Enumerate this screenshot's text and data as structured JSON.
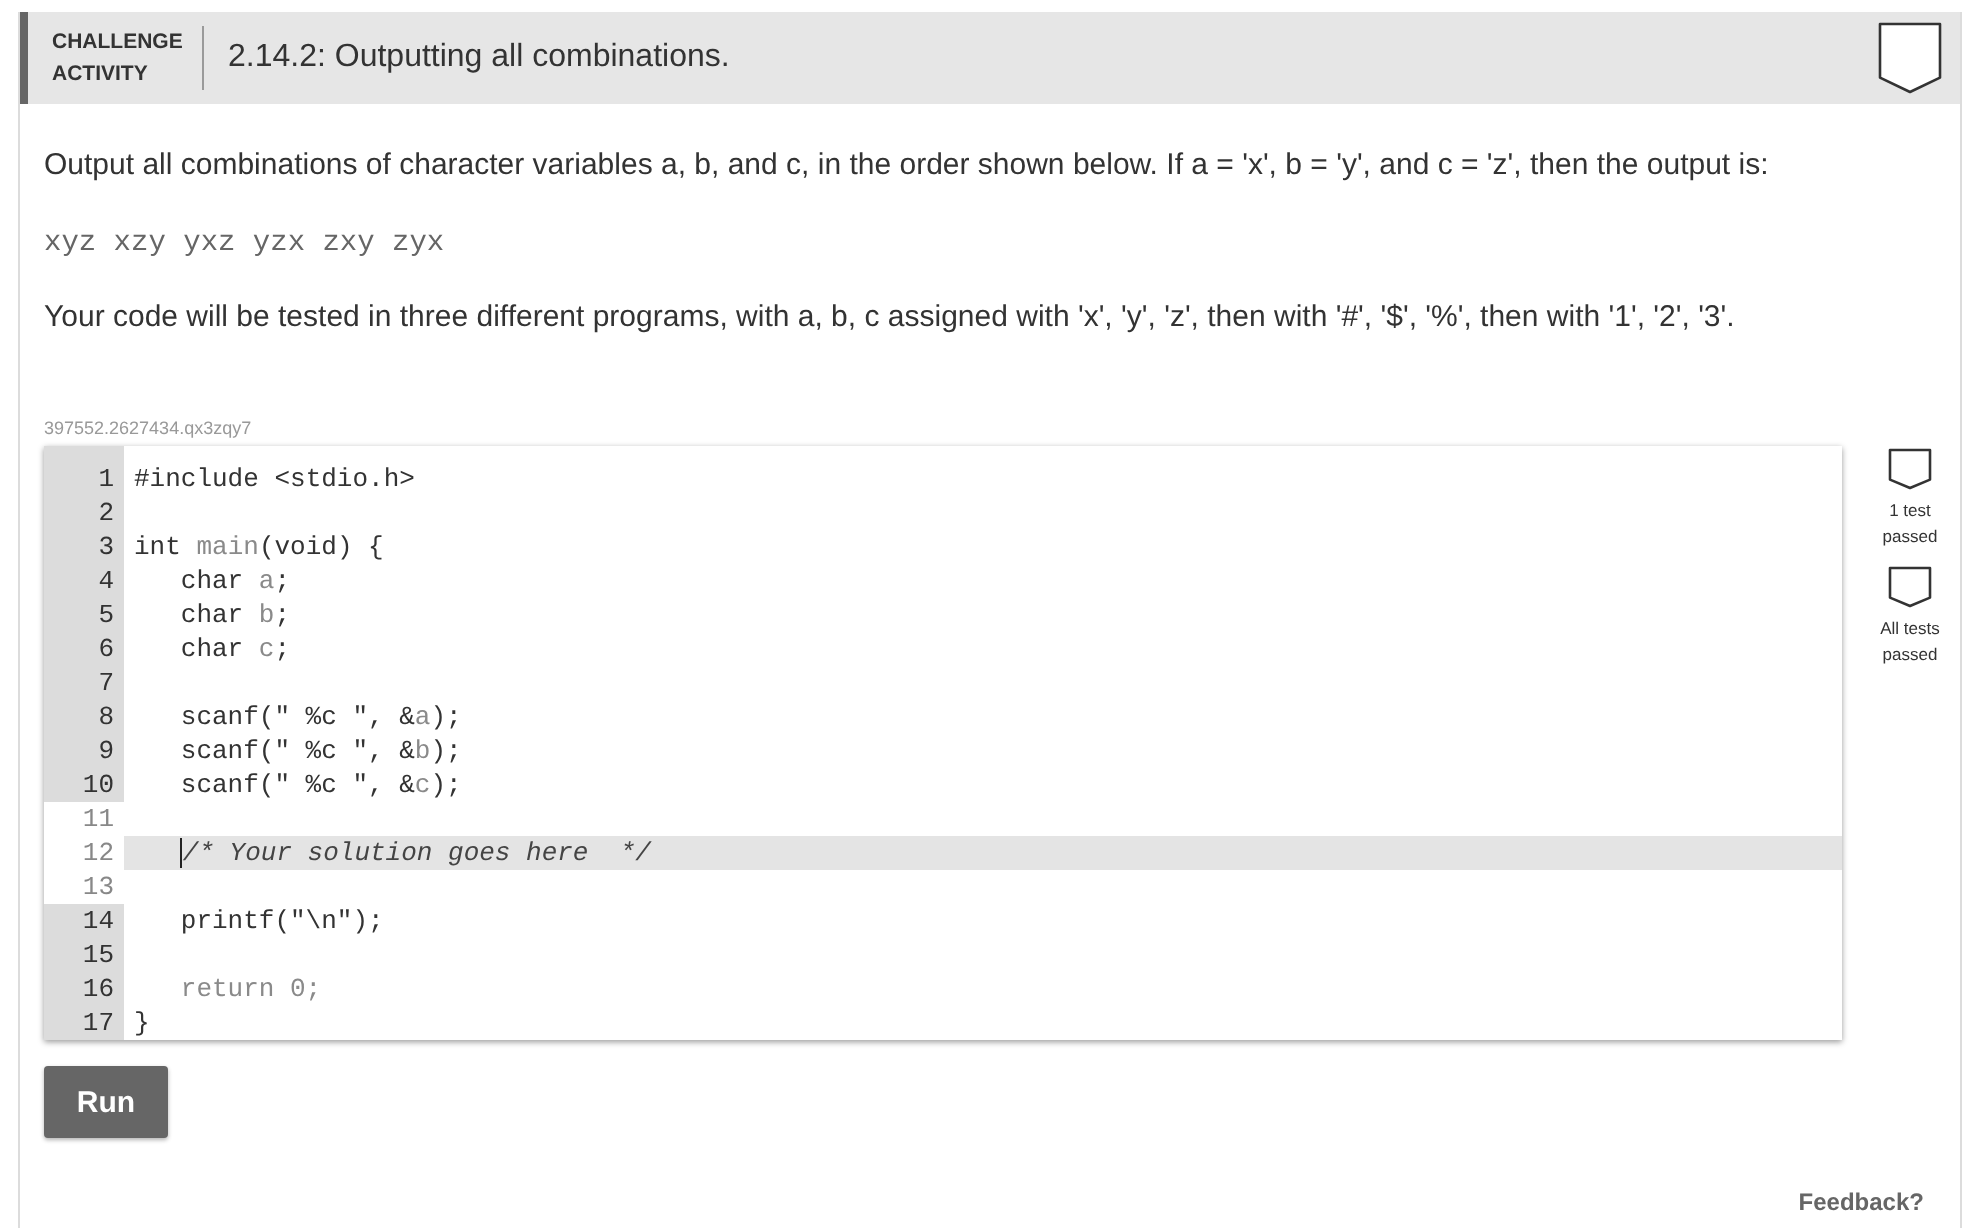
{
  "header": {
    "type_label": "CHALLENGE ACTIVITY",
    "title": "2.14.2: Outputting all combinations.",
    "completed": false
  },
  "instructions": [
    {
      "kind": "text",
      "text": "Output all combinations of character variables a, b, and c, in the order shown below. If a = 'x', b = 'y', and c = 'z', then the output is:"
    },
    {
      "kind": "code",
      "text": "xyz xzy yxz yzx zxy zyx"
    },
    {
      "kind": "text",
      "text": "Your code will be tested in three different programs, with a, b, c assigned with 'x', 'y', 'z', then with '#', '$', '%', then with '1', '2', '3'."
    }
  ],
  "activity_id": "397552.2627434.qx3zqy7",
  "editor": {
    "lines": [
      {
        "number": "1",
        "editable": false,
        "active": false,
        "indented": false,
        "tokens": [
          {
            "kind": "plain",
            "text": "#include <stdio.h>"
          }
        ]
      },
      {
        "number": "2",
        "editable": false,
        "active": false
      },
      {
        "number": "3",
        "editable": false,
        "active": false,
        "indented": false,
        "tokens": [
          {
            "kind": "plain",
            "text": "int "
          },
          {
            "kind": "muted",
            "text": "main"
          },
          {
            "kind": "plain",
            "text": "(void) {"
          }
        ]
      },
      {
        "number": "4",
        "editable": false,
        "active": false,
        "indented": true,
        "tokens": [
          {
            "kind": "plain",
            "text": "char "
          },
          {
            "kind": "muted",
            "text": "a"
          },
          {
            "kind": "plain",
            "text": ";"
          }
        ]
      },
      {
        "number": "5",
        "editable": false,
        "active": false,
        "indented": true,
        "tokens": [
          {
            "kind": "plain",
            "text": "char "
          },
          {
            "kind": "muted",
            "text": "b"
          },
          {
            "kind": "plain",
            "text": ";"
          }
        ]
      },
      {
        "number": "6",
        "editable": false,
        "active": false,
        "indented": true,
        "tokens": [
          {
            "kind": "plain",
            "text": "char "
          },
          {
            "kind": "muted",
            "text": "c"
          },
          {
            "kind": "plain",
            "text": ";"
          }
        ]
      },
      {
        "number": "7",
        "editable": false,
        "active": false
      },
      {
        "number": "8",
        "editable": false,
        "active": false,
        "indented": true,
        "tokens": [
          {
            "kind": "plain",
            "text": "scanf(\" %c \", &"
          },
          {
            "kind": "muted",
            "text": "a"
          },
          {
            "kind": "plain",
            "text": ");"
          }
        ]
      },
      {
        "number": "9",
        "editable": false,
        "active": false,
        "indented": true,
        "tokens": [
          {
            "kind": "plain",
            "text": "scanf(\" %c \", &"
          },
          {
            "kind": "muted",
            "text": "b"
          },
          {
            "kind": "plain",
            "text": ");"
          }
        ]
      },
      {
        "number": "10",
        "editable": false,
        "active": false,
        "indented": true,
        "tokens": [
          {
            "kind": "plain",
            "text": "scanf(\" %c \", &"
          },
          {
            "kind": "muted",
            "text": "c"
          },
          {
            "kind": "plain",
            "text": ");"
          }
        ]
      },
      {
        "number": "11",
        "editable": true,
        "active": false
      },
      {
        "number": "12",
        "editable": true,
        "active": true,
        "indented": true,
        "tokens": [
          {
            "kind": "cursor"
          },
          {
            "kind": "comment",
            "text": "/* Your solution goes here  */"
          }
        ]
      },
      {
        "number": "13",
        "editable": true,
        "active": false
      },
      {
        "number": "14",
        "editable": false,
        "active": false,
        "indented": true,
        "tokens": [
          {
            "kind": "plain",
            "text": "printf(\"\\n\");"
          }
        ]
      },
      {
        "number": "15",
        "editable": false,
        "active": false
      },
      {
        "number": "16",
        "editable": false,
        "active": false,
        "indented": true,
        "tokens": [
          {
            "kind": "muted",
            "text": "return 0;"
          }
        ]
      },
      {
        "number": "17",
        "editable": false,
        "active": false,
        "indented": false,
        "tokens": [
          {
            "kind": "plain",
            "text": "}"
          }
        ]
      }
    ]
  },
  "tests": [
    {
      "label": "1 test passed",
      "passed": false
    },
    {
      "label": "All tests passed",
      "passed": false
    }
  ],
  "run_button": "Run",
  "feedback_link": "Feedback?"
}
